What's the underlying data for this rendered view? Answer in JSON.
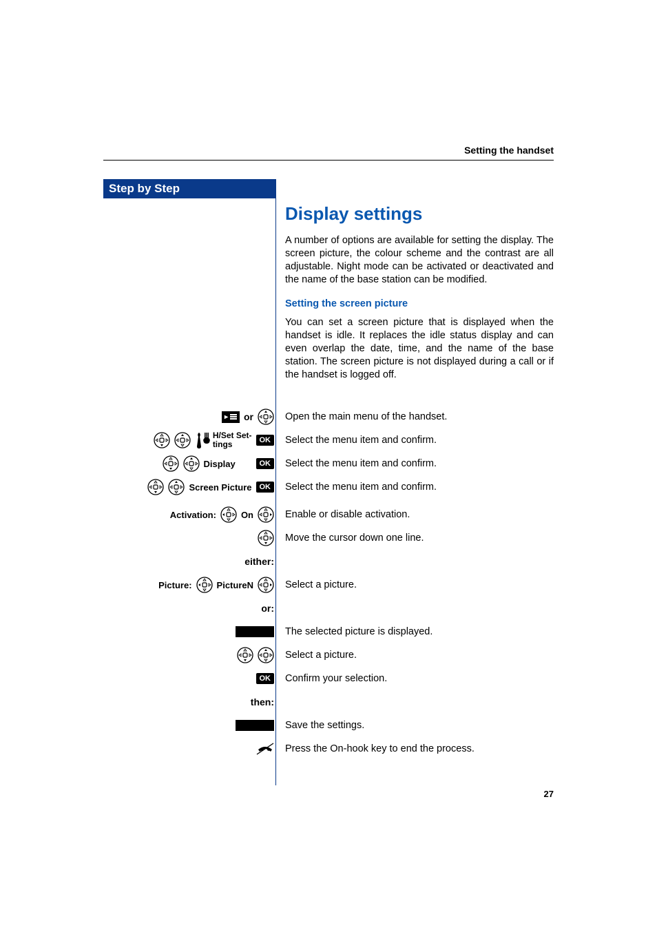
{
  "running_head": "Setting the handset",
  "sidebar_title": "Step by Step",
  "title": "Display settings",
  "intro": "A number of options are available for setting the display. The screen picture, the colour scheme and the contrast are all adjustable. Night mode can be activated or deactivated and the name of the base station can be modified.",
  "subhead": "Setting the screen picture",
  "desc": "You can set a screen picture that is displayed when the handset is idle. It replaces the idle status display and can even overlap the date, time, and the name of the base station. The screen picture is not displayed during a call or if the handset is logged off.",
  "labels": {
    "or": "or",
    "ok": "OK",
    "hset": "H/Set Settings",
    "display": "Display",
    "screen_picture": "Screen Picture",
    "activation": "Activation:",
    "on": "On",
    "either": "either:",
    "picture": "Picture:",
    "pictureN": "PictureN",
    "or2": "or:",
    "then": "then:"
  },
  "step_text": {
    "open_menu": "Open the main menu of the handset.",
    "select_confirm": "Select the menu item and confirm.",
    "enable_disable": "Enable or disable activation.",
    "cursor_down": "Move the cursor down one line.",
    "select_picture": "Select a picture.",
    "selected_displayed": "The selected picture is displayed.",
    "confirm": "Confirm your selection.",
    "save": "Save the settings.",
    "onhook": "Press the On-hook key to end the process."
  },
  "page_number": "27"
}
